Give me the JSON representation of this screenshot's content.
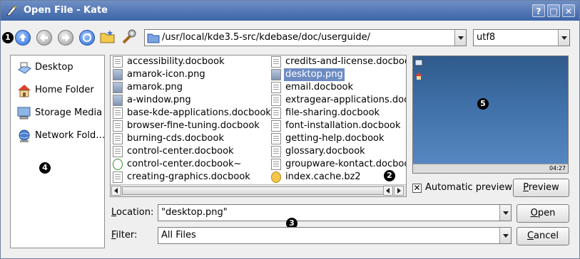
{
  "window": {
    "title": "Open File - Kate",
    "help_glyph": "?",
    "max_glyph": "□",
    "close_glyph": "✕"
  },
  "toolbar": {
    "path": "/usr/local/kde3.5-src/kdebase/doc/userguide/",
    "encoding": "utf8",
    "icons": [
      "up-icon",
      "back-icon",
      "forward-icon",
      "reload-icon",
      "new-folder-icon",
      "configure-icon"
    ]
  },
  "sidebar": {
    "items": [
      {
        "label": "Desktop",
        "icon": "desktop-icon"
      },
      {
        "label": "Home Folder",
        "icon": "home-icon"
      },
      {
        "label": "Storage Media",
        "icon": "storage-icon"
      },
      {
        "label": "Network Fold…",
        "icon": "network-icon"
      }
    ]
  },
  "files": {
    "left": [
      {
        "name": "accessibility.docbook",
        "kind": "doc"
      },
      {
        "name": "amarok-icon.png",
        "kind": "img"
      },
      {
        "name": "amarok.png",
        "kind": "img"
      },
      {
        "name": "a-window.png",
        "kind": "img"
      },
      {
        "name": "base-kde-applications.docbook",
        "kind": "doc"
      },
      {
        "name": "browser-fine-tuning.docbook",
        "kind": "doc"
      },
      {
        "name": "burning-cds.docbook",
        "kind": "doc"
      },
      {
        "name": "control-center.docbook",
        "kind": "doc"
      },
      {
        "name": "control-center.docbook~",
        "kind": "html"
      },
      {
        "name": "creating-graphics.docbook",
        "kind": "doc"
      }
    ],
    "right": [
      {
        "name": "credits-and-license.docbook",
        "kind": "doc"
      },
      {
        "name": "desktop.png",
        "kind": "img",
        "selected": true
      },
      {
        "name": "email.docbook",
        "kind": "doc"
      },
      {
        "name": "extragear-applications.doc",
        "kind": "doc"
      },
      {
        "name": "file-sharing.docbook",
        "kind": "doc"
      },
      {
        "name": "font-installation.docbook",
        "kind": "doc"
      },
      {
        "name": "getting-help.docbook",
        "kind": "doc"
      },
      {
        "name": "glossary.docbook",
        "kind": "doc"
      },
      {
        "name": "groupware-kontact.docbook",
        "kind": "doc"
      },
      {
        "name": "index.cache.bz2",
        "kind": "bz"
      }
    ]
  },
  "preview": {
    "auto_label": "Automatic preview",
    "auto_checked": true,
    "check_glyph": "✕",
    "clock": "04:27",
    "button_label": "Preview",
    "button_mnemonic": "P",
    "button_rest": "review"
  },
  "location": {
    "label_mnemonic": "L",
    "label_rest": "ocation:",
    "value": "\"desktop.png\"",
    "open_mnemonic": "O",
    "open_rest": "pen"
  },
  "filter": {
    "label_mnemonic": "F",
    "label_rest": "ilter:",
    "value": "All Files",
    "cancel_mnemonic": "C",
    "cancel_rest": "ancel"
  },
  "callouts": [
    "1",
    "2",
    "3",
    "4",
    "5"
  ]
}
